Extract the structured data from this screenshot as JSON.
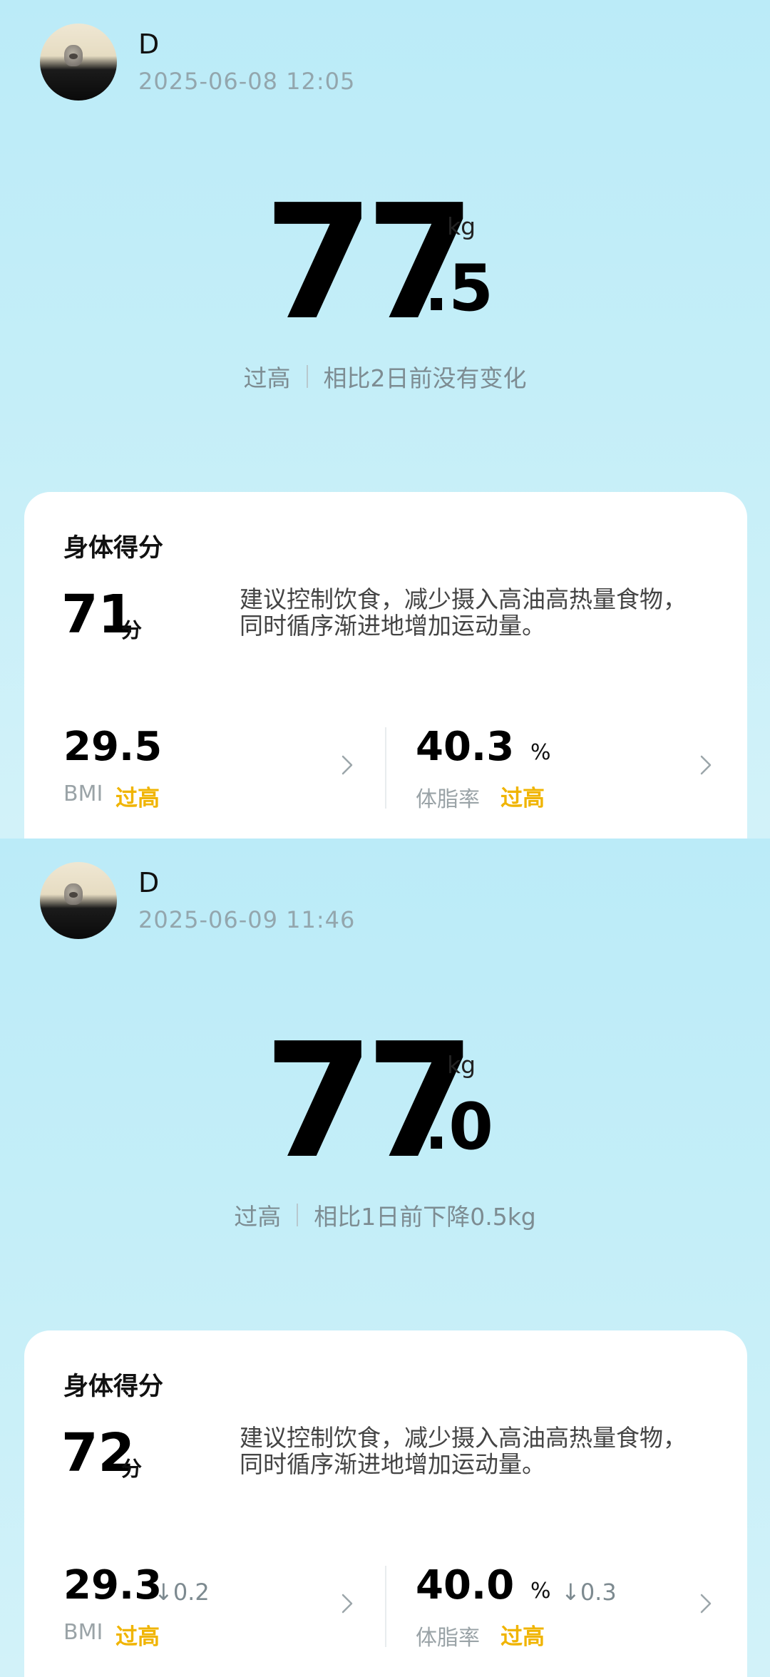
{
  "records": [
    {
      "user": {
        "name": "D",
        "timestamp": "2025-06-08 12:05"
      },
      "weight": {
        "integer": "77",
        "decimal": ".5",
        "unit": "kg",
        "status": "过高",
        "comparison": "相比2日前没有变化"
      },
      "body_score": {
        "title": "身体得分",
        "score": "71",
        "unit": "分",
        "advice": "建议控制饮食，减少摄入高油高热量食物，同时循序渐进地增加运动量。"
      },
      "bmi": {
        "value": "29.5",
        "label": "BMI",
        "status": "过高",
        "change": ""
      },
      "body_fat": {
        "value": "40.3",
        "unit": "%",
        "label": "体脂率",
        "status": "过高",
        "change": ""
      }
    },
    {
      "user": {
        "name": "D",
        "timestamp": "2025-06-09 11:46"
      },
      "weight": {
        "integer": "77",
        "decimal": ".0",
        "unit": "kg",
        "status": "过高",
        "comparison": "相比1日前下降0.5kg"
      },
      "body_score": {
        "title": "身体得分",
        "score": "72",
        "unit": "分",
        "advice": "建议控制饮食，减少摄入高油高热量食物，同时循序渐进地增加运动量。"
      },
      "bmi": {
        "value": "29.3",
        "label": "BMI",
        "status": "过高",
        "change": "↓0.2"
      },
      "body_fat": {
        "value": "40.0",
        "unit": "%",
        "label": "体脂率",
        "status": "过高",
        "change": "↓0.3"
      }
    }
  ],
  "colors": {
    "status_warning": "#f0b400",
    "background": "#c4eef8"
  },
  "icons": {
    "avatar": "user-avatar-photo",
    "chevron": "chevron-right-icon"
  }
}
